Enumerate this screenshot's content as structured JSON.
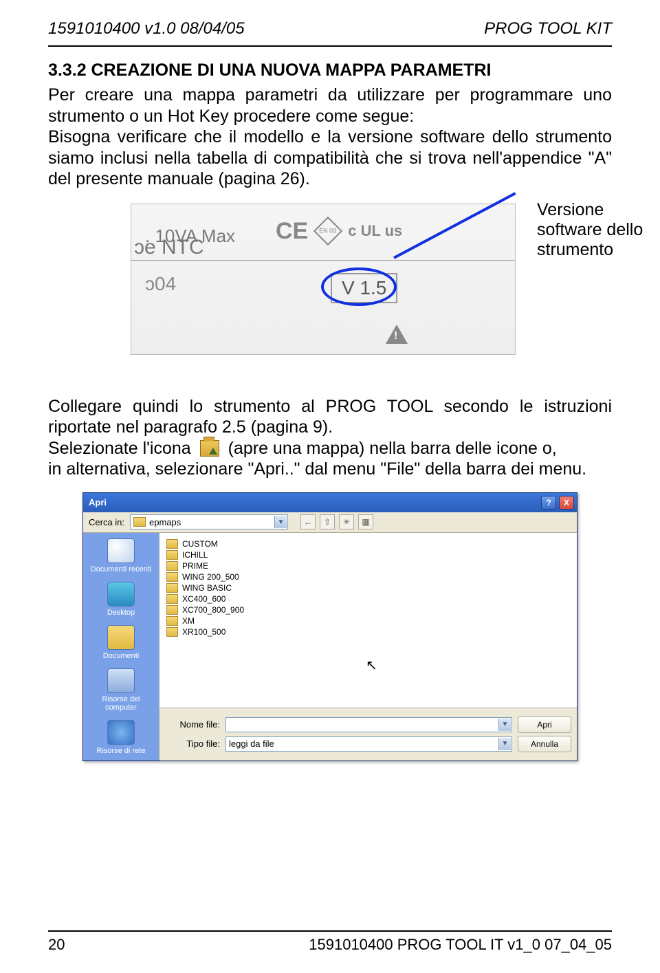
{
  "header": {
    "left": "1591010400 v1.0 08/04/05",
    "right": "PROG TOOL KIT"
  },
  "section_title": "3.3.2 CREAZIONE DI UNA NUOVA MAPPA PARAMETRI",
  "para1": "Per creare una mappa parametri da utilizzare per programmare uno strumento o un Hot Key procedere come segue:",
  "para1b": "Bisogna verificare che il modello e la versione software dello strumento siamo inclusi nella tabella di compatibilità che si trova nell'appendice \"A\" del presente manuale (pagina 26).",
  "figure": {
    "max": ". 10VA Max",
    "ntc": "ɔe NTC",
    "ce": "CE",
    "en": "EN 03",
    "ul": "c UL us",
    "code": "ͻ04",
    "version": "V 1.5",
    "callout_l1": "Versione",
    "callout_l2": "software dello",
    "callout_l3": "strumento"
  },
  "para2a": "Collegare quindi lo strumento al PROG TOOL secondo le istruzioni riportate nel paragrafo 2.5 (pagina 9).",
  "para2b_pre": "Selezionate l'icona",
  "para2b_post": "(apre una mappa) nella barra delle icone o,",
  "para2c": "in alternativa, selezionare \"Apri..\" dal menu \"File\" della barra dei menu.",
  "dialog": {
    "title": "Apri",
    "help": "?",
    "close": "X",
    "look_in_label": "Cerca in:",
    "look_in_value": "epmaps",
    "sidebar": [
      "Documenti recenti",
      "Desktop",
      "Documenti",
      "Risorse del computer",
      "Risorse di rete"
    ],
    "folders": [
      "CUSTOM",
      "ICHILL",
      "PRIME",
      "WING 200_500",
      "WING BASIC",
      "XC400_600",
      "XC700_800_900",
      "XM",
      "XR100_500"
    ],
    "filename_label": "Nome file:",
    "filename_value": "",
    "filetype_label": "Tipo file:",
    "filetype_value": "leggi da file",
    "open_btn": "Apri",
    "cancel_btn": "Annulla",
    "tool_back": "←",
    "tool_up": "⇧",
    "tool_new": "✳",
    "tool_view": "▦"
  },
  "footer": {
    "page": "20",
    "right": "1591010400 PROG TOOL IT v1_0 07_04_05"
  }
}
